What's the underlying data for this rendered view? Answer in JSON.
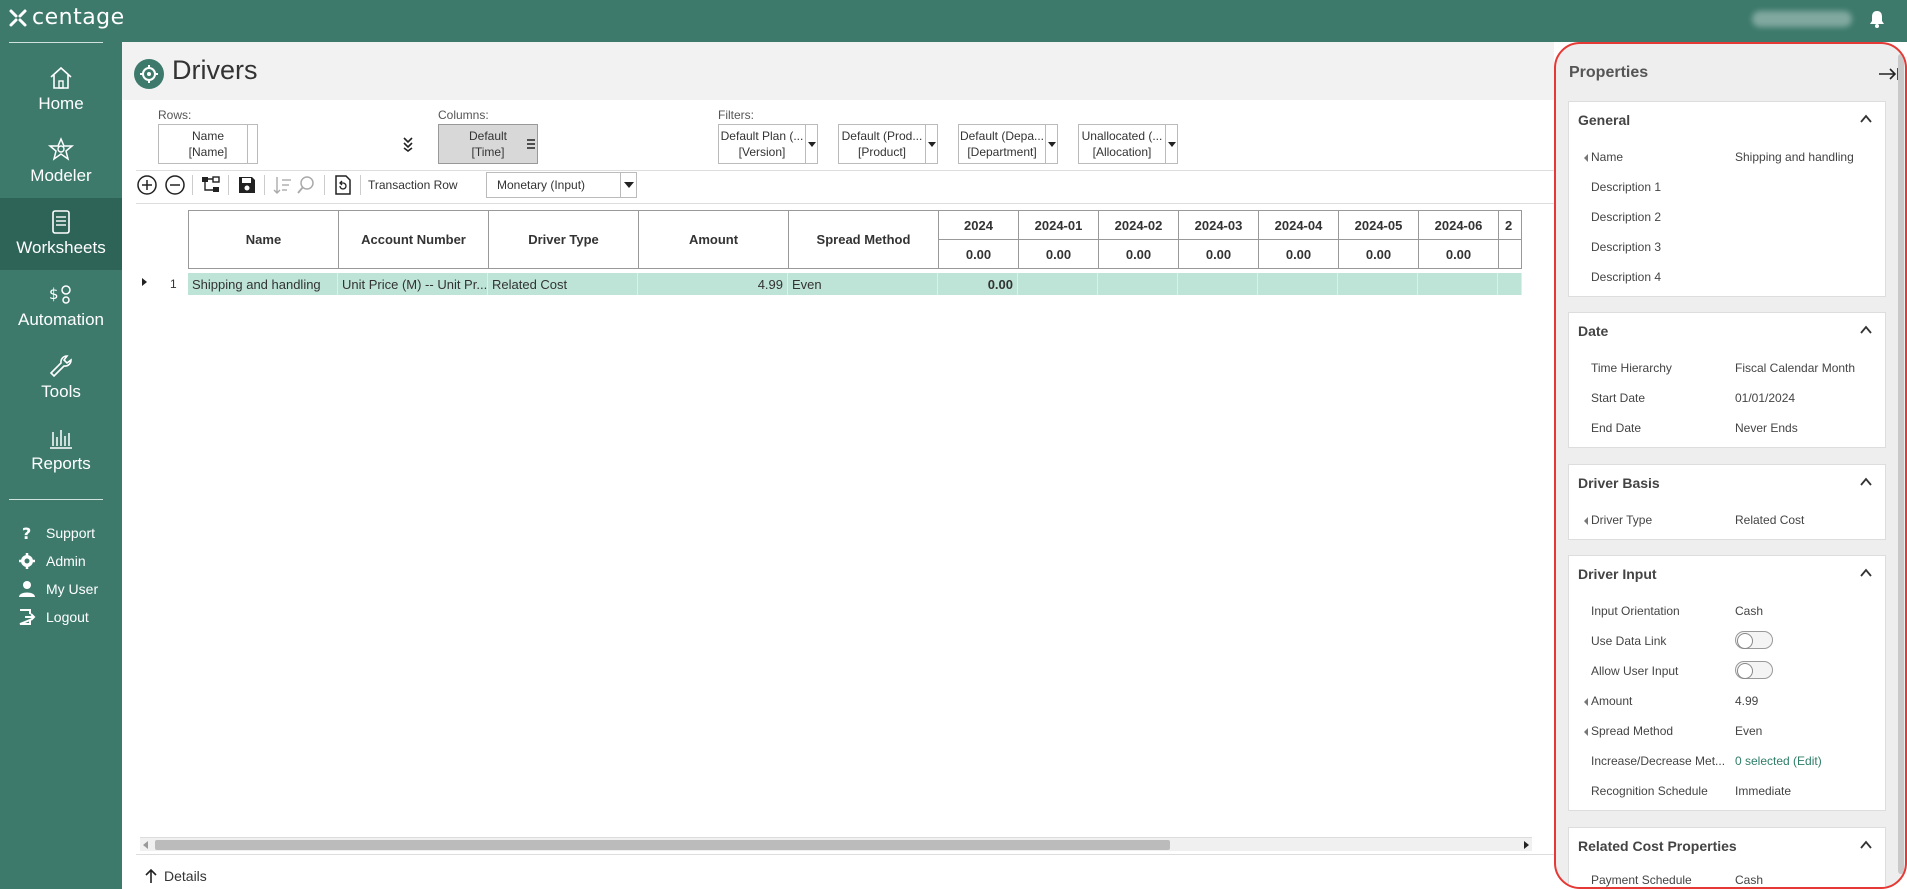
{
  "app": {
    "logo_text": "centage"
  },
  "sidebar": {
    "items": [
      {
        "label": "Home",
        "icon": "home-icon"
      },
      {
        "label": "Modeler",
        "icon": "modeler-icon"
      },
      {
        "label": "Worksheets",
        "icon": "worksheets-icon",
        "active": true
      },
      {
        "label": "Automation",
        "icon": "automation-icon"
      },
      {
        "label": "Tools",
        "icon": "wrench-icon"
      },
      {
        "label": "Reports",
        "icon": "reports-icon"
      }
    ],
    "bottom": [
      {
        "label": "Support",
        "icon": "question-icon"
      },
      {
        "label": "Admin",
        "icon": "gear-icon"
      },
      {
        "label": "My User",
        "icon": "user-icon"
      },
      {
        "label": "Logout",
        "icon": "logout-icon"
      }
    ]
  },
  "page": {
    "title": "Drivers"
  },
  "pivot": {
    "rows_label": "Rows:",
    "rows_dim": {
      "line1": "Name",
      "line2": "[Name]"
    },
    "columns_label": "Columns:",
    "columns_dim": {
      "line1": "Default",
      "line2": "[Time]"
    },
    "filters_label": "Filters:",
    "filters": [
      {
        "line1": "Default Plan (...",
        "line2": "[Version]"
      },
      {
        "line1": "Default (Prod...",
        "line2": "[Product]"
      },
      {
        "line1": "Default (Depa...",
        "line2": "[Department]"
      },
      {
        "line1": "Unallocated (...",
        "line2": "[Allocation]"
      }
    ]
  },
  "toolbar": {
    "transaction_row_label": "Transaction Row",
    "transaction_row_value": "Monetary (Input)"
  },
  "grid": {
    "headers": [
      "Name",
      "Account Number",
      "Driver Type",
      "Amount",
      "Spread Method"
    ],
    "period_headers": [
      "2024",
      "2024-01",
      "2024-02",
      "2024-03",
      "2024-04",
      "2024-05",
      "2024-06",
      "2"
    ],
    "period_totals": [
      "0.00",
      "0.00",
      "0.00",
      "0.00",
      "0.00",
      "0.00",
      "0.00",
      ""
    ],
    "rows": [
      {
        "number": "1",
        "name": "Shipping and handling",
        "account_number": "Unit Price (M) -- Unit Pr...",
        "driver_type": "Related Cost",
        "amount": "4.99",
        "spread_method": "Even",
        "year_value": "0.00"
      }
    ]
  },
  "footer": {
    "details_label": "Details"
  },
  "properties": {
    "title": "Properties",
    "sections": {
      "general": {
        "title": "General",
        "rows": [
          {
            "label": "Name",
            "value": "Shipping and handling"
          },
          {
            "label": "Description 1",
            "value": ""
          },
          {
            "label": "Description 2",
            "value": ""
          },
          {
            "label": "Description 3",
            "value": ""
          },
          {
            "label": "Description 4",
            "value": ""
          }
        ]
      },
      "date": {
        "title": "Date",
        "rows": [
          {
            "label": "Time Hierarchy",
            "value": "Fiscal Calendar Month"
          },
          {
            "label": "Start Date",
            "value": "01/01/2024"
          },
          {
            "label": "End Date",
            "value": "Never Ends"
          }
        ]
      },
      "driver_basis": {
        "title": "Driver Basis",
        "rows": [
          {
            "label": "Driver Type",
            "value": "Related Cost"
          }
        ]
      },
      "driver_input": {
        "title": "Driver Input",
        "rows": [
          {
            "label": "Input Orientation",
            "value": "Cash"
          },
          {
            "label": "Use Data Link",
            "value": false
          },
          {
            "label": "Allow User Input",
            "value": false
          },
          {
            "label": "Amount",
            "value": "4.99"
          },
          {
            "label": "Spread Method",
            "value": "Even"
          },
          {
            "label": "Increase/Decrease Met...",
            "value": "0 selected (Edit)"
          },
          {
            "label": "Recognition Schedule",
            "value": "Immediate"
          }
        ]
      },
      "related_cost": {
        "title": "Related Cost Properties",
        "rows": [
          {
            "label": "Payment Schedule",
            "value": "Cash"
          }
        ]
      }
    }
  },
  "colors": {
    "brand": "#3d7a6c",
    "brand_dark": "#2e6457",
    "row_highlight": "#bde4d7",
    "focus_outline": "#e53935"
  }
}
